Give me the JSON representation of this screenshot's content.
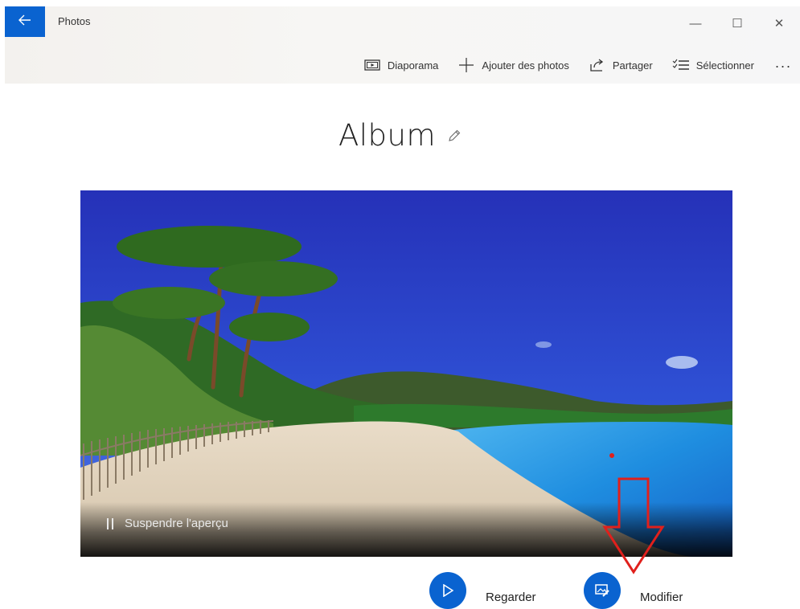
{
  "window": {
    "title": "Photos",
    "controls": {
      "minimize": "—",
      "maximize": "☐",
      "close": "✕"
    }
  },
  "toolbar": {
    "items": [
      {
        "label": "Diaporama",
        "icon": "slideshow-icon"
      },
      {
        "label": "Ajouter des photos",
        "icon": "plus-icon"
      },
      {
        "label": "Partager",
        "icon": "share-icon"
      },
      {
        "label": "Sélectionner",
        "icon": "select-list-icon"
      }
    ],
    "more": "..."
  },
  "album": {
    "title": "Album",
    "edit_icon": "pencil-icon"
  },
  "hero": {
    "pause_label": "Suspendre l'aperçu",
    "pause_icon": "pause-icon"
  },
  "actions": {
    "watch": {
      "label": "Regarder",
      "icon": "play-icon"
    },
    "edit": {
      "label": "Modifier",
      "icon": "edit-photo-icon"
    }
  },
  "colors": {
    "accent": "#0a63d0",
    "annotation_arrow": "#e0201c"
  }
}
